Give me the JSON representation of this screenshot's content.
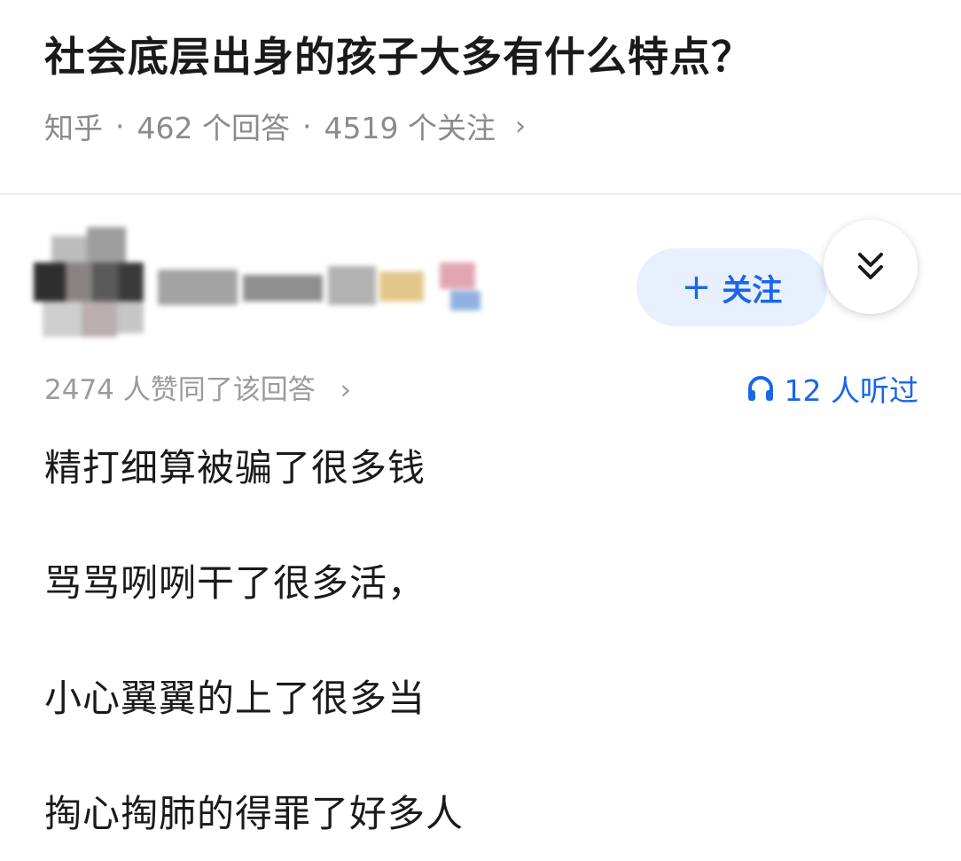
{
  "question": {
    "title": "社会底层出身的孩子大多有什么特点？",
    "source": "知乎",
    "answers": "462 个回答",
    "followers": "4519 个关注",
    "separator": "·",
    "chevron": "›"
  },
  "author": {
    "follow_label": "关注",
    "follow_icon": "plus-icon",
    "expand_icon": "double-chevron-down-icon"
  },
  "answer": {
    "upvotes_text": "2474 人赞同了该回答",
    "chevron": "›",
    "listened_text": "12 人听过",
    "listened_icon": "headphones-icon",
    "lines": [
      "精打细算被骗了很多钱",
      "骂骂咧咧干了很多活，",
      "小心翼翼的上了很多当",
      "掏心掏肺的得罪了好多人"
    ]
  },
  "colors": {
    "accent": "#1a66e8",
    "follow_bg": "#e8f0fd",
    "meta_gray": "#8a8a8f"
  }
}
